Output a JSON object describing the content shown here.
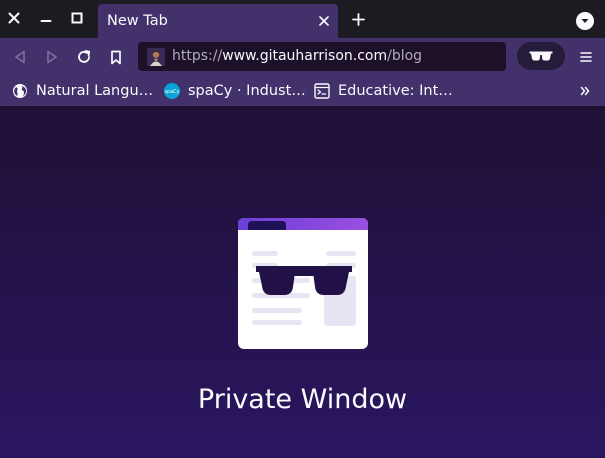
{
  "tab": {
    "title": "New Tab"
  },
  "urlbar": {
    "scheme": "https://",
    "host": "www.gitauharrison.com",
    "path": "/blog"
  },
  "bookmarks": [
    {
      "label": "Natural Langu…",
      "icon": "globe-icon"
    },
    {
      "label": "spaCy · Indust…",
      "icon": "spacy-icon"
    },
    {
      "label": "Educative: Int…",
      "icon": "educative-icon"
    }
  ],
  "content": {
    "heading": "Private Window"
  },
  "colors": {
    "toolbar": "#42316b",
    "tabstrip": "#1c1b22",
    "content_top": "#1f1136",
    "content_bottom": "#2a1660",
    "accent": "#8c7bff"
  }
}
